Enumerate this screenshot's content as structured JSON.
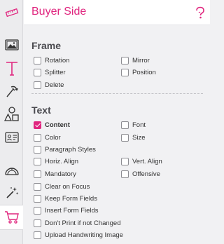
{
  "header": {
    "title": "Buyer Side"
  },
  "frame": {
    "title": "Frame",
    "options": [
      {
        "label": "Rotation",
        "checked": false
      },
      {
        "label": "Mirror",
        "checked": false
      },
      {
        "label": "Splitter",
        "checked": false
      },
      {
        "label": "Position",
        "checked": false
      },
      {
        "label": "Delete",
        "checked": false
      }
    ]
  },
  "text": {
    "title": "Text",
    "options": [
      {
        "label": "Content",
        "checked": true
      },
      {
        "label": "Font",
        "checked": false
      },
      {
        "label": "Color",
        "checked": false
      },
      {
        "label": "Size",
        "checked": false
      },
      {
        "label": "Paragraph Styles",
        "checked": false
      },
      {
        "label": "Horiz. Align",
        "checked": false
      },
      {
        "label": "Vert. Align",
        "checked": false
      },
      {
        "label": "Mandatory",
        "checked": false
      },
      {
        "label": "Offensive",
        "checked": false
      },
      {
        "label": "Clear on Focus",
        "checked": false
      },
      {
        "label": "Keep Form Fields",
        "checked": false
      },
      {
        "label": "Insert Form Fields",
        "checked": false
      },
      {
        "label": "Don't Print if not Changed",
        "checked": false
      },
      {
        "label": "Upload Handwriting Image",
        "checked": false
      }
    ]
  },
  "toolbar": {
    "tools": [
      {
        "name": "ruler-icon"
      },
      {
        "name": "image-icon"
      },
      {
        "name": "text-icon"
      },
      {
        "name": "crop-rotate-icon"
      },
      {
        "name": "shapes-icon"
      },
      {
        "name": "id-card-icon"
      },
      {
        "name": "gauge-icon"
      },
      {
        "name": "magic-wand-icon"
      },
      {
        "name": "cart-icon",
        "active": true
      }
    ]
  },
  "colors": {
    "accent": "#e0267f",
    "text": "#333333",
    "section": "#4a4a4f"
  }
}
